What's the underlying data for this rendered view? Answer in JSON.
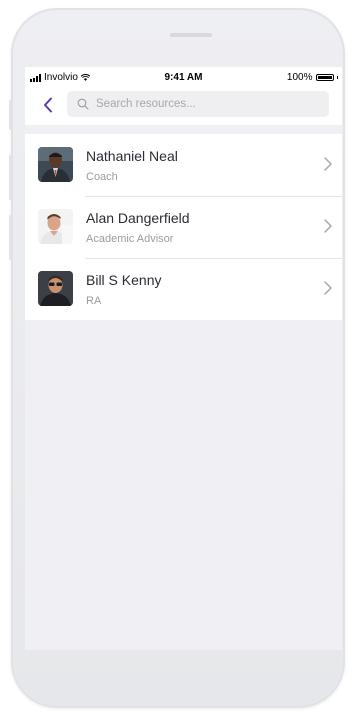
{
  "status_bar": {
    "carrier": "Involvio",
    "time": "9:41 AM",
    "battery": "100%"
  },
  "search": {
    "placeholder": "Search resources..."
  },
  "resources": [
    {
      "name": "Nathaniel Neal",
      "role": "Coach",
      "avatar_icon": "avatar-photo"
    },
    {
      "name": "Alan Dangerfield",
      "role": "Academic Advisor",
      "avatar_icon": "avatar-photo"
    },
    {
      "name": "Bill S Kenny",
      "role": "RA",
      "avatar_icon": "avatar-photo"
    }
  ],
  "colors": {
    "accent": "#5b3f9e",
    "background": "#efeff4"
  }
}
